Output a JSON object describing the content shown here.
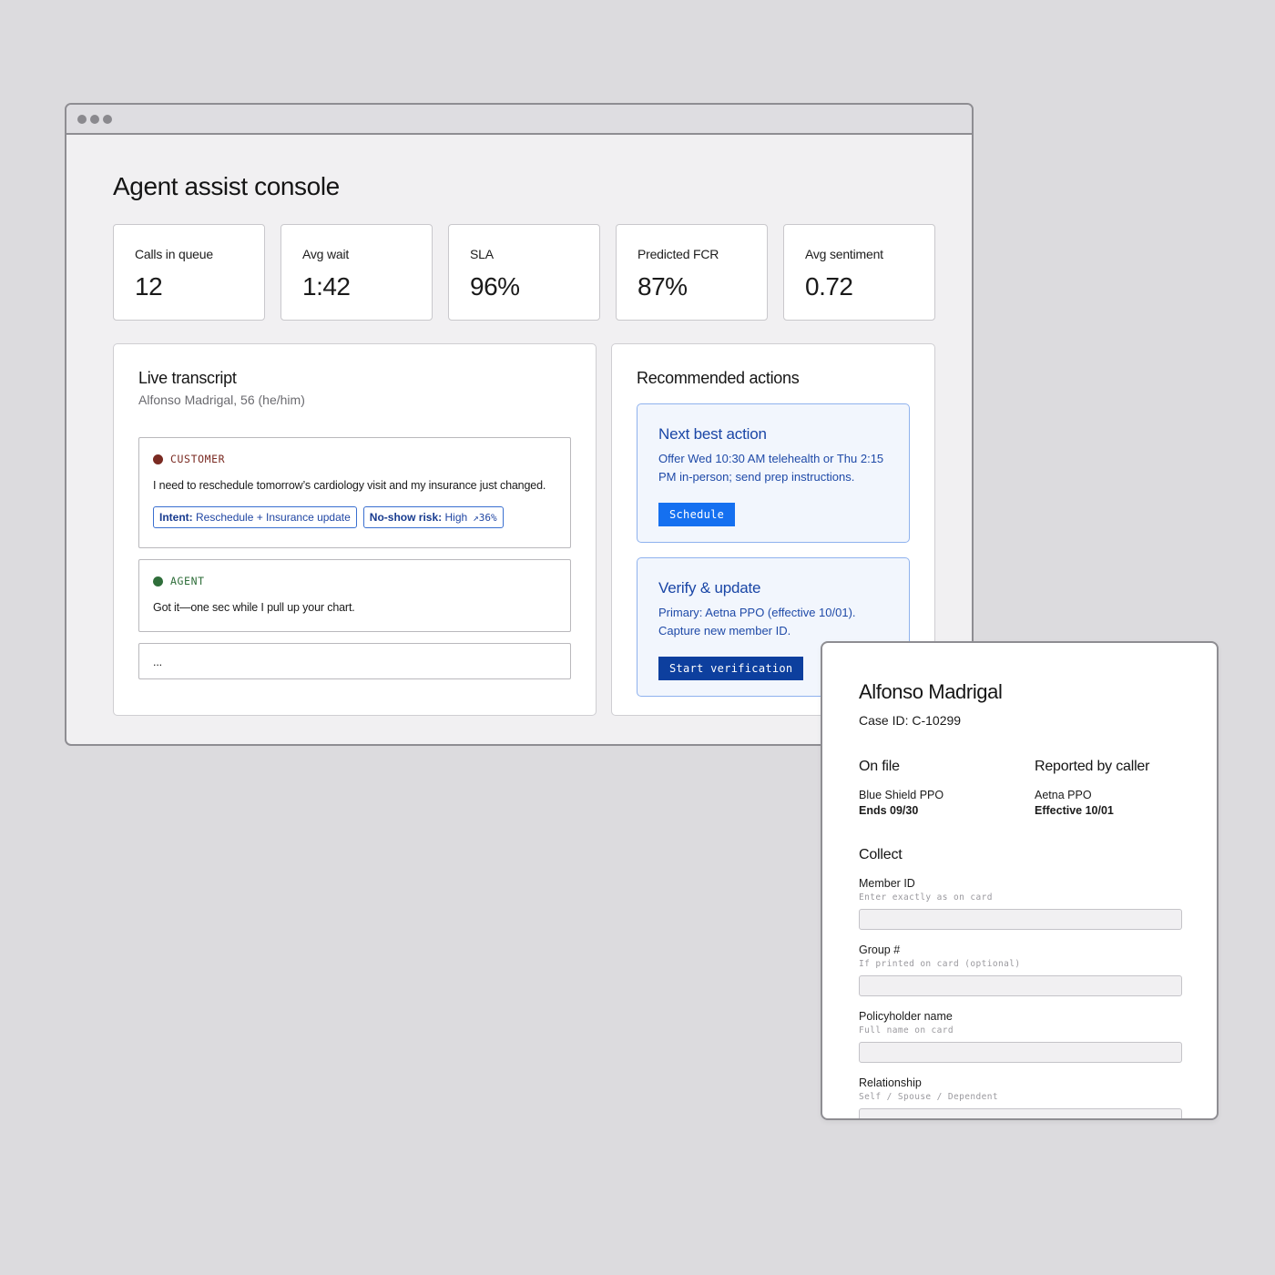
{
  "console": {
    "title": "Agent assist console",
    "kpis": [
      {
        "label": "Calls in queue",
        "value": "12"
      },
      {
        "label": "Avg wait",
        "value": "1:42"
      },
      {
        "label": "SLA",
        "value": "96%"
      },
      {
        "label": "Predicted FCR",
        "value": "87%"
      },
      {
        "label": "Avg sentiment",
        "value": "0.72"
      }
    ]
  },
  "transcript": {
    "title": "Live transcript",
    "subtitle": "Alfonso Madrigal, 56 (he/him)",
    "customer": {
      "speaker": "CUSTOMER",
      "text": "I need to reschedule tomorrow’s cardiology visit and my insurance just changed.",
      "intent_key": "Intent:",
      "intent_value": "Reschedule + Insurance update",
      "risk_key": "No-show risk:",
      "risk_value": "High",
      "risk_trend": "↗36%"
    },
    "agent": {
      "speaker": "AGENT",
      "text": "Got it—one sec while I pull up your chart."
    },
    "pending": "..."
  },
  "actions": {
    "title": "Recommended actions",
    "next_best": {
      "title": "Next best action",
      "text": "Offer Wed 10:30 AM telehealth or Thu 2:15 PM in-person; send prep instructions.",
      "button": "Schedule"
    },
    "verify": {
      "title": "Verify & update",
      "text": "Primary: Aetna PPO (effective 10/01). Capture new member ID.",
      "button": "Start verification"
    }
  },
  "case": {
    "name": "Alfonso Madrigal",
    "case_id": "Case ID: C-10299",
    "on_file": {
      "heading": "On file",
      "plan": "Blue Shield PPO",
      "detail": "Ends 09/30"
    },
    "reported": {
      "heading": "Reported by caller",
      "plan": "Aetna PPO",
      "detail": "Effective 10/01"
    },
    "collect_heading": "Collect",
    "fields": [
      {
        "label": "Member ID",
        "hint": "Enter exactly as on card"
      },
      {
        "label": "Group #",
        "hint": "If printed on card (optional)"
      },
      {
        "label": "Policyholder name",
        "hint": "Full name on card"
      },
      {
        "label": "Relationship",
        "hint": "Self / Spouse / Dependent"
      }
    ]
  },
  "colors": {
    "customer_dot": "#7a2a22",
    "customer_label": "#7a2a22",
    "agent_dot": "#2f6e3a",
    "agent_label": "#2f6e3a",
    "primary_button": "#1570f0",
    "dark_button": "#0d3f9e"
  }
}
